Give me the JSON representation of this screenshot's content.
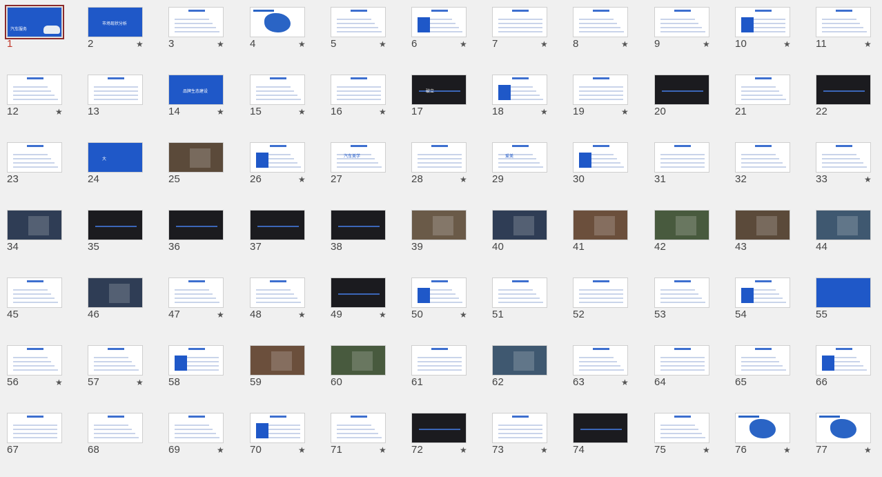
{
  "slides": [
    {
      "n": "1",
      "star": false,
      "theme": "title",
      "text": "汽车服务"
    },
    {
      "n": "2",
      "star": true,
      "theme": "blue",
      "text": "市场现状分析"
    },
    {
      "n": "3",
      "star": true,
      "theme": "white"
    },
    {
      "n": "4",
      "star": true,
      "theme": "map"
    },
    {
      "n": "5",
      "star": true,
      "theme": "white"
    },
    {
      "n": "6",
      "star": true,
      "theme": "white"
    },
    {
      "n": "7",
      "star": true,
      "theme": "white"
    },
    {
      "n": "8",
      "star": true,
      "theme": "white"
    },
    {
      "n": "9",
      "star": true,
      "theme": "white"
    },
    {
      "n": "10",
      "star": true,
      "theme": "white"
    },
    {
      "n": "11",
      "star": true,
      "theme": "white"
    },
    {
      "n": "12",
      "star": true,
      "theme": "white"
    },
    {
      "n": "13",
      "star": false,
      "theme": "white"
    },
    {
      "n": "14",
      "star": true,
      "theme": "blue",
      "text": "品牌生态建设"
    },
    {
      "n": "15",
      "star": true,
      "theme": "white"
    },
    {
      "n": "16",
      "star": true,
      "theme": "white"
    },
    {
      "n": "17",
      "star": false,
      "theme": "dark",
      "text": "破立"
    },
    {
      "n": "18",
      "star": true,
      "theme": "white"
    },
    {
      "n": "19",
      "star": true,
      "theme": "white"
    },
    {
      "n": "20",
      "star": false,
      "theme": "dark"
    },
    {
      "n": "21",
      "star": false,
      "theme": "white"
    },
    {
      "n": "22",
      "star": false,
      "theme": "dark"
    },
    {
      "n": "23",
      "star": false,
      "theme": "white"
    },
    {
      "n": "24",
      "star": false,
      "theme": "blue",
      "text": "大"
    },
    {
      "n": "25",
      "star": false,
      "theme": "photo"
    },
    {
      "n": "26",
      "star": true,
      "theme": "white"
    },
    {
      "n": "27",
      "star": false,
      "theme": "white",
      "text": "汽车美学"
    },
    {
      "n": "28",
      "star": true,
      "theme": "white"
    },
    {
      "n": "29",
      "star": false,
      "theme": "white",
      "text": "爱美"
    },
    {
      "n": "30",
      "star": false,
      "theme": "white"
    },
    {
      "n": "31",
      "star": false,
      "theme": "white"
    },
    {
      "n": "32",
      "star": false,
      "theme": "white"
    },
    {
      "n": "33",
      "star": true,
      "theme": "white"
    },
    {
      "n": "34",
      "star": false,
      "theme": "photo"
    },
    {
      "n": "35",
      "star": false,
      "theme": "dark"
    },
    {
      "n": "36",
      "star": false,
      "theme": "dark"
    },
    {
      "n": "37",
      "star": false,
      "theme": "dark"
    },
    {
      "n": "38",
      "star": false,
      "theme": "dark"
    },
    {
      "n": "39",
      "star": false,
      "theme": "photo"
    },
    {
      "n": "40",
      "star": false,
      "theme": "photo"
    },
    {
      "n": "41",
      "star": false,
      "theme": "photo"
    },
    {
      "n": "42",
      "star": false,
      "theme": "photo"
    },
    {
      "n": "43",
      "star": false,
      "theme": "photo"
    },
    {
      "n": "44",
      "star": false,
      "theme": "photo"
    },
    {
      "n": "45",
      "star": false,
      "theme": "white"
    },
    {
      "n": "46",
      "star": false,
      "theme": "photo"
    },
    {
      "n": "47",
      "star": true,
      "theme": "white"
    },
    {
      "n": "48",
      "star": true,
      "theme": "white"
    },
    {
      "n": "49",
      "star": true,
      "theme": "dark"
    },
    {
      "n": "50",
      "star": true,
      "theme": "white"
    },
    {
      "n": "51",
      "star": false,
      "theme": "white"
    },
    {
      "n": "52",
      "star": false,
      "theme": "white"
    },
    {
      "n": "53",
      "star": false,
      "theme": "white"
    },
    {
      "n": "54",
      "star": false,
      "theme": "white"
    },
    {
      "n": "55",
      "star": false,
      "theme": "blue"
    },
    {
      "n": "56",
      "star": true,
      "theme": "white"
    },
    {
      "n": "57",
      "star": true,
      "theme": "white"
    },
    {
      "n": "58",
      "star": false,
      "theme": "white"
    },
    {
      "n": "59",
      "star": false,
      "theme": "photo"
    },
    {
      "n": "60",
      "star": false,
      "theme": "photo"
    },
    {
      "n": "61",
      "star": false,
      "theme": "white"
    },
    {
      "n": "62",
      "star": false,
      "theme": "photo"
    },
    {
      "n": "63",
      "star": true,
      "theme": "white"
    },
    {
      "n": "64",
      "star": false,
      "theme": "white"
    },
    {
      "n": "65",
      "star": false,
      "theme": "white"
    },
    {
      "n": "66",
      "star": false,
      "theme": "white"
    },
    {
      "n": "67",
      "star": false,
      "theme": "white"
    },
    {
      "n": "68",
      "star": false,
      "theme": "white"
    },
    {
      "n": "69",
      "star": true,
      "theme": "white"
    },
    {
      "n": "70",
      "star": true,
      "theme": "white"
    },
    {
      "n": "71",
      "star": true,
      "theme": "white"
    },
    {
      "n": "72",
      "star": true,
      "theme": "dark"
    },
    {
      "n": "73",
      "star": true,
      "theme": "white"
    },
    {
      "n": "74",
      "star": false,
      "theme": "dark"
    },
    {
      "n": "75",
      "star": true,
      "theme": "white"
    },
    {
      "n": "76",
      "star": true,
      "theme": "map"
    },
    {
      "n": "77",
      "star": true,
      "theme": "map"
    }
  ],
  "selected": "1",
  "star_glyph": "★",
  "colors": {
    "accent": "#1f58c8",
    "selection": "#8a2a2a",
    "background": "#f0f0f0"
  }
}
